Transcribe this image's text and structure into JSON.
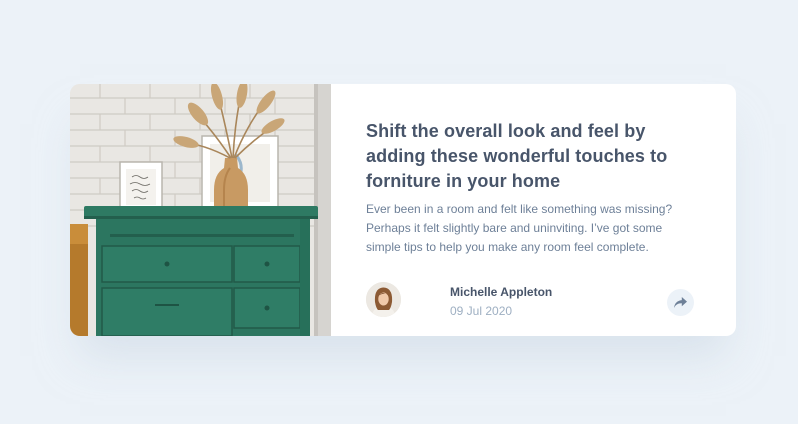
{
  "article": {
    "title": "Shift the overall look and feel by adding these wonderful touches to forniture in your home",
    "description": "Ever been in a room and felt like something was missing? Perhaps it felt slightly bare and uninviting. I’ve got some simple tips to help you make any room feel complete.",
    "image_icon": "drawers-photo"
  },
  "author": {
    "name": "Michelle Appleton",
    "date": "09 Jul 2020",
    "avatar_icon": "avatar-photo"
  },
  "share": {
    "icon": "share-icon"
  },
  "colors": {
    "background": "#ecf2f8",
    "title": "#48556a",
    "text": "#6e8098",
    "muted": "#9eafc2"
  }
}
